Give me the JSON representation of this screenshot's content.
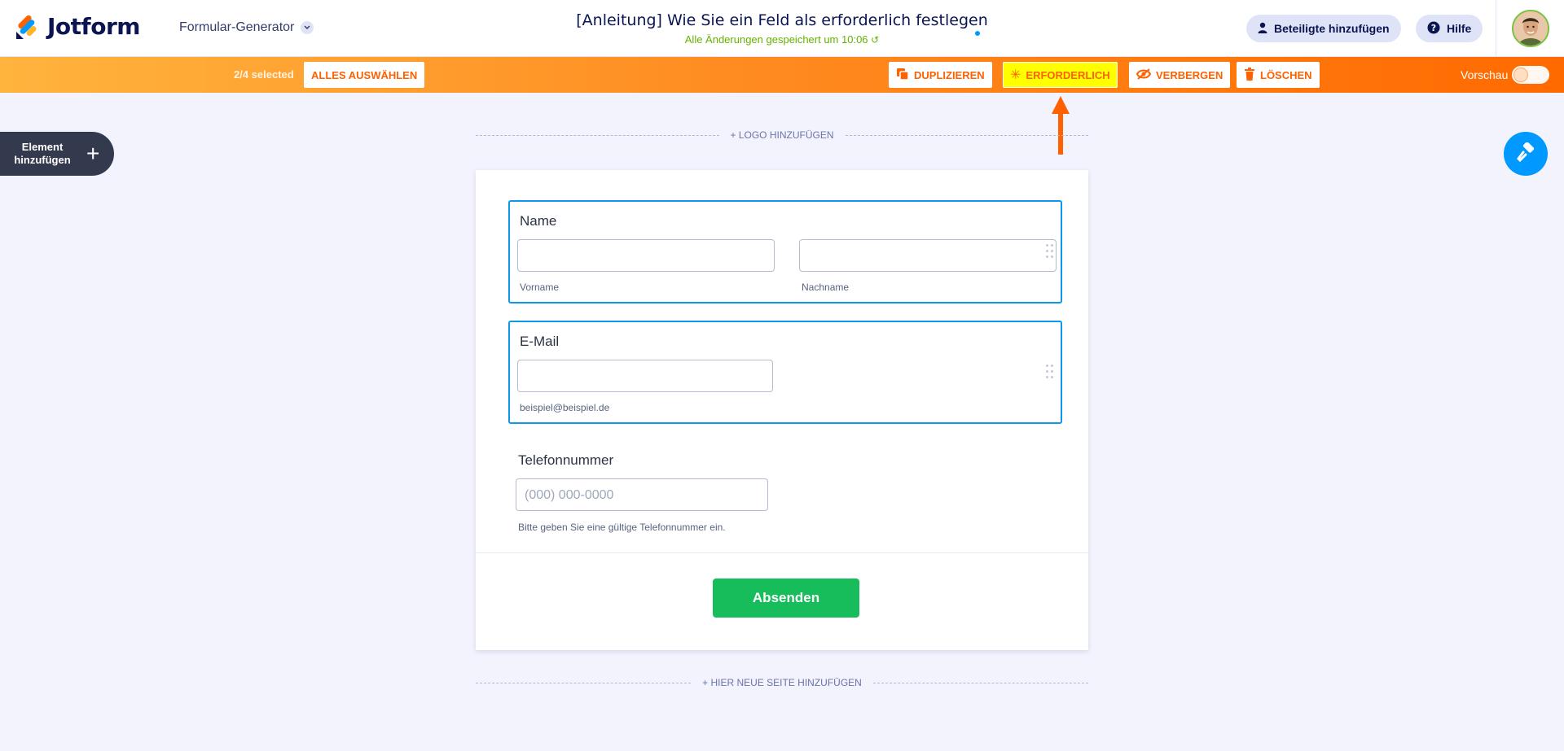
{
  "header": {
    "brand": "Jotform",
    "builder_label": "Formular-Generator",
    "title": "[Anleitung] Wie Sie ein Feld als erforderlich festlegen",
    "saved_status": "Alle Änderungen gespeichert um 10:06",
    "invite_label": "Beteiligte hinzufügen",
    "help_label": "Hilfe"
  },
  "toolbar": {
    "selected_count": "2/4 selected",
    "select_all": "ALLES AUSWÄHLEN",
    "duplicate": "DUPLIZIEREN",
    "required": "ERFORDERLICH",
    "hide": "VERBERGEN",
    "delete": "LÖSCHEN",
    "preview": "Vorschau"
  },
  "sidebar": {
    "add_element_line1": "Element",
    "add_element_line2": "hinzufügen"
  },
  "canvas": {
    "add_logo": "+ LOGO HINZUFÜGEN",
    "add_page": "+ HIER NEUE SEITE HINZUFÜGEN"
  },
  "form": {
    "name": {
      "label": "Name",
      "first_sublabel": "Vorname",
      "last_sublabel": "Nachname"
    },
    "email": {
      "label": "E-Mail",
      "sublabel": "beispiel@beispiel.de"
    },
    "phone": {
      "label": "Telefonnummer",
      "placeholder": "(000) 000-0000",
      "sublabel": "Bitte geben Sie eine gültige Telefonnummer ein."
    },
    "submit_label": "Absenden"
  },
  "colors": {
    "accent_orange": "#ff6100",
    "selection_blue": "#0c97e8",
    "submit_green": "#18bd5b",
    "required_highlight": "#ffff00"
  }
}
